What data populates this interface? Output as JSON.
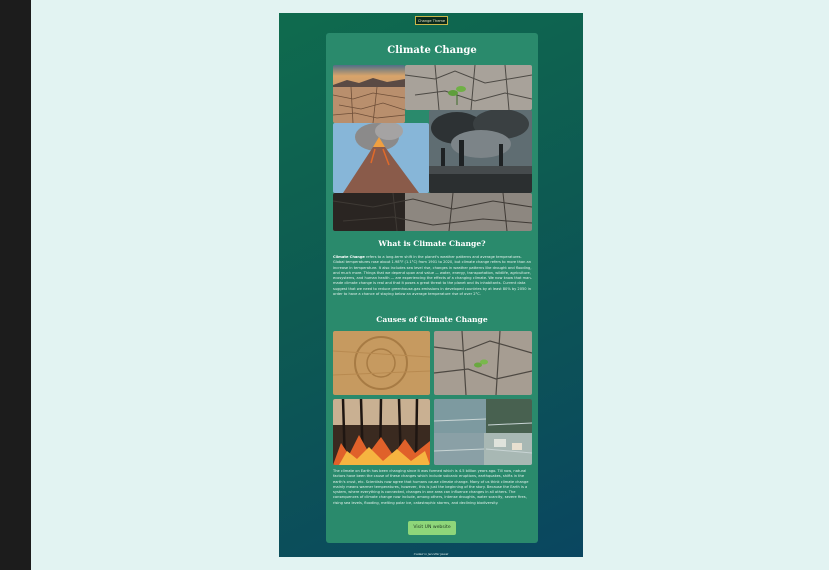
{
  "header": {
    "theme_button": "Change Theme"
  },
  "main": {
    "title": "Climate Change",
    "section1": {
      "heading": "What is Climate Change?",
      "lead": "Climate Change",
      "body": " refers to a long-term shift in the planet's weather patterns and average temperatures. Global temperatures rose about 1.98°F (1.1°C) from 1901 to 2020, but climate change refers to more than an increase in temperature. It also includes sea level rise, changes in weather patterns like drought and flooding, and much more. Things that we depend upon and value — water, energy, transportation, wildlife, agriculture, ecosystems, and human health — are experiencing the effects of a changing climate. We now know that man-made climate change is real and that it poses a great threat to the planet and its inhabitants. Current data suggest that we need to reduce greenhouse-gas emissions in developed countries by at least 80% by 2050 in order to have a chance of staying below an average temperature rise of over 2°C."
    },
    "section2": {
      "heading": "Causes of Climate Change",
      "body": "The climate on Earth has been changing since it was formed which is 4.5 billion years ago. Till now, natural factors have been the cause of these changes which include volcanic eruptions, earthquakes, shifts in the earth's crust, etc. Scientists now agree that humans cause climate change. Many of us think climate change mainly means warmer temperatures, however, this is just the beginning of the story. Because the Earth is a system, where everything is connected, changes in one area can influence changes in all others. The consequences of climate change now include, among others, intense droughts, water scarcity, severe fires, rising sea levels, flooding, melting polar ice, catastrophic storms, and declining biodiversity."
    },
    "un_button": "Visit UN website"
  },
  "footer": {
    "credit": "Coded in Jennifer Jewel"
  }
}
